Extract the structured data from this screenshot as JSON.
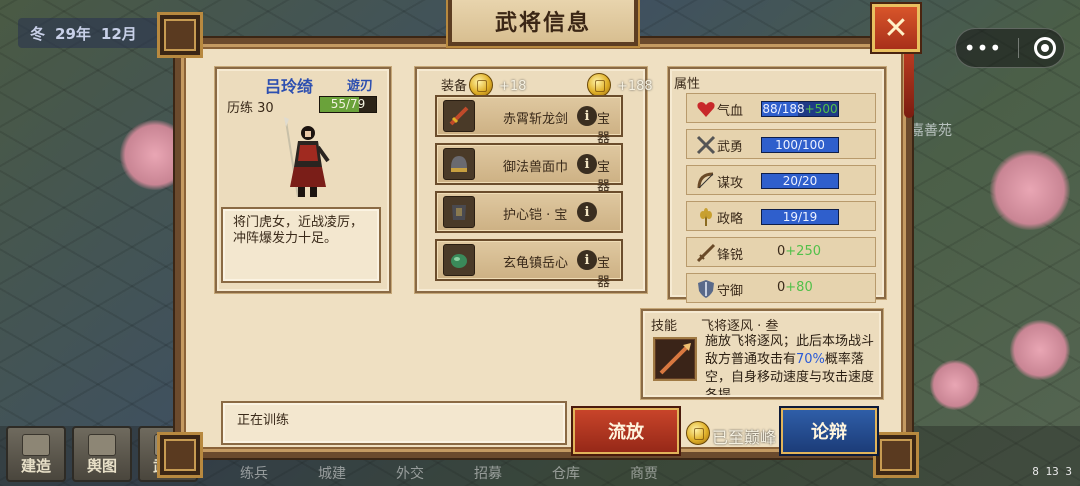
{
  "background": {
    "date_season": "冬",
    "date_year": "29年",
    "date_month": "12月",
    "map_label": "嘉善苑",
    "dock": [
      "建造",
      "舆图",
      "武将"
    ],
    "bottom_labels": [
      "练兵",
      "城建",
      "外交",
      "招募",
      "仓库",
      "商贾"
    ],
    "clock": "8 13 3"
  },
  "capsule": {
    "menu_glyph": "•••"
  },
  "dialog": {
    "title": "武将信息",
    "close_glyph": "✕"
  },
  "hero": {
    "name": "吕玲绮",
    "class": "遊刃",
    "exp_label": "历练 30",
    "exp_text": "55/79",
    "exp_fraction": 0.696,
    "description": "将门虎女，近战凌厉，冲阵爆发力十足。"
  },
  "equipment": {
    "header": "装备",
    "coin_left_bonus": "+18",
    "coin_right_bonus": "+188",
    "info_glyph": "i",
    "items": [
      {
        "name": "赤霄斩龙剑",
        "tag": "宝器",
        "icon": "sword-icon",
        "color": "#c04a2a"
      },
      {
        "name": "御法兽面巾",
        "tag": "宝器",
        "icon": "helmet-icon",
        "color": "#6a6a70"
      },
      {
        "name": "护心铠 · 宝",
        "tag": "",
        "icon": "armor-icon",
        "color": "#4a4a50"
      },
      {
        "name": "玄龟镇岳心",
        "tag": "宝器",
        "icon": "jade-icon",
        "color": "#3a8a5a"
      }
    ]
  },
  "attributes": {
    "header": "属性",
    "rows": [
      {
        "key": "hp",
        "label": "气血",
        "icon": "heart-icon",
        "base": "88/188",
        "bonus": "+500",
        "fraction": 0.468,
        "bar": true
      },
      {
        "key": "martial",
        "label": "武勇",
        "icon": "crossed-swords-icon",
        "base": "100/100",
        "bonus": "",
        "fraction": 1.0,
        "bar": true
      },
      {
        "key": "strategy",
        "label": "谋攻",
        "icon": "bow-icon",
        "base": "20/20",
        "bonus": "",
        "fraction": 1.0,
        "bar": true
      },
      {
        "key": "tactics",
        "label": "政略",
        "icon": "wheat-icon",
        "base": "19/19",
        "bonus": "",
        "fraction": 1.0,
        "bar": true
      },
      {
        "key": "sharpness",
        "label": "锋锐",
        "icon": "sword-icon",
        "base": "0",
        "bonus": "+250",
        "bar": false
      },
      {
        "key": "defense",
        "label": "守御",
        "icon": "shield-icon",
        "base": "0",
        "bonus": "+80",
        "bar": false
      }
    ]
  },
  "skill": {
    "header": "技能",
    "name": "飞将逐风 · 叁",
    "desc_before": "施放飞将逐风；此后本场战斗敌方普通攻击有",
    "desc_highlight": "70%",
    "desc_after": "概率落空，自身移动速度与攻击速度各提"
  },
  "status": {
    "text": "正在训练"
  },
  "actions": {
    "exile_label": "流放",
    "peak_label": "已至巅峰",
    "debate_label": "论辩"
  },
  "colors": {
    "hero_name": "#2d4fb0",
    "bonus_green": "#52c04a",
    "highlight_blue": "#2a5ad8",
    "exile_red": "#b83620",
    "debate_blue": "#274e92"
  }
}
